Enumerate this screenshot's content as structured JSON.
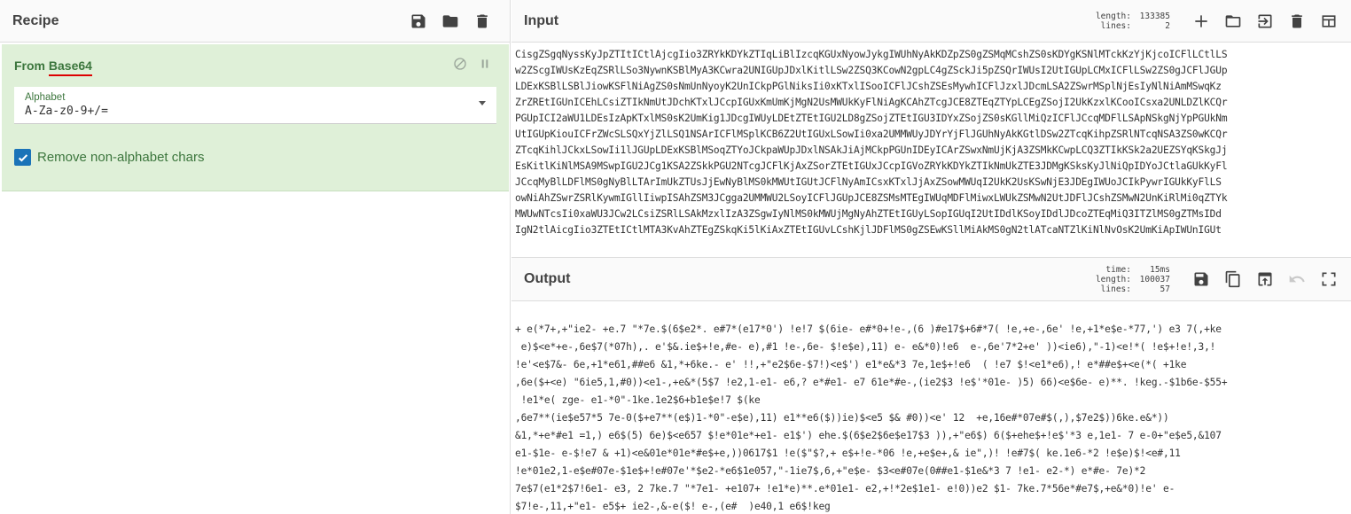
{
  "recipe": {
    "title": "Recipe",
    "operation": {
      "name_prefix": "From ",
      "name_highlight": "Base64",
      "arg_label": "Alphabet",
      "arg_value": "A-Za-z0-9+/=",
      "checkbox_label": "Remove non-alphabet chars",
      "checkbox_checked": true
    }
  },
  "input": {
    "title": "Input",
    "stats": {
      "length_label": "length:",
      "length_value": "133385",
      "lines_label": "lines:",
      "lines_value": "2"
    },
    "lines": [
      "CisgZSgqNyssKyJpZTItICtlAjcgIio3ZRYkKDYkZTIqLiBlIzcqKGUxNyowJykgIWUhNyAkKDZpZS0gZSMqMCshZS0sKDYgKSNlMTckKzYjKjcoICFlLCtlLS",
      "w2ZScgIWUsKzEqZSRlLSo3NywnKSBlMyA3KCwra2UNIGUpJDxlKitlLSw2ZSQ3KCowN2gpLC4gZSckJi5pZSQrIWUsI2UtIGUpLCMxICFlLSw2ZS0gJCFlJGUp",
      "LDExKSBlLSBlJiowKSFlNiAgZS0sNmUnNyoyK2UnICkpPGlNiksIi0xKTxlISooICFlJCshZSEsMywhICFlJzxlJDcmLSA2ZSwrMSplNjEsIyNlNiAmMSwqKz",
      "ZrZREtIGUnICEhLCsiZTIkNmUtJDchKTxlJCcpIGUxKmUmKjMgN2UsMWUkKyFlNiAgKCAhZTcgJCE8ZTEqZTYpLCEgZSojI2UkKzxlKCooICsxa2UNLDZlKCQr",
      "PGUpICI2aWU1LDEsIzApKTxlMS0sK2UmKig1JDcgIWUyLDEtZTEtIGU2LD8gZSojZTEtIGU3IDYxZSojZS0sKGllMiQzICFlJCcqMDFlLSApNSkgNjYpPGUkNm",
      "UtIGUpKiouICFrZWcSLSQxYjZlLSQ1NSArICFlMSplKCB6Z2UtIGUxLSowIi0xa2UMMWUyJDYrYjFlJGUhNyAkKGtlDSw2ZTcqKihpZSRlNTcqNSA3ZS0wKCQr",
      "ZTcqKihlJCkxLSowIi1lJGUpLDExKSBlMSoqZTYoJCkpaWUpJDxlNSAkJiAjMCkpPGUnIDEyICArZSwxNmUjKjA3ZSMkKCwpLCQ3ZTIkKSk2a2UEZSYqKSkgJj",
      "EsKitlKiNlMSA9MSwpIGU2JCg1KSA2ZSkkPGU2NTcgJCFlKjAxZSorZTEtIGUxJCcpIGVoZRYkKDYkZTIkNmUkZTE3JDMgKSksKyJlNiQpIDYoJCtlaGUkKyFl",
      "JCcqMyBlLDFlMS0gNyBlLTArImUkZTUsJjEwNyBlMS0kMWUtIGUtJCFlNyAmICsxKTxlJjAxZSowMWUqI2UkK2UsKSwNjE3JDEgIWUoJCIkPywrIGUkKyFlLS",
      "owNiAhZSwrZSRlKywmIGllIiwpISAhZSM3JCgga2UMMWU2LSoyICFlJGUpJCE8ZSMsMTEgIWUqMDFlMiwxLWUkZSMwN2UtJDFlJCshZSMwN2UnKiRlMi0qZTYk",
      "MWUwNTcsIi0xaWU3JCw2LCsiZSRlLSAkMzxlIzA3ZSgwIyNlMS0kMWUjMgNyAhZTEtIGUyLSopIGUqI2UtIDdlKSoyIDdlJDcoZTEqMiQ3ITZlMS0gZTMsIDd",
      "IgN2tlAicgIio3ZTEtICtlMTA3KvAhZTEgZSkqKi5lKiAxZTEtIGUvLCshKjlJDFlMS0gZSEwKSllMiAkMS0gN2tlATcaNTZlKiNlNvOsK2UmKiApIWUnIGUt"
    ]
  },
  "output": {
    "title": "Output",
    "stats": {
      "time_label": "time:",
      "time_value": "15ms",
      "length_label": "length:",
      "length_value": "100037",
      "lines_label": "lines:",
      "lines_value": "57"
    },
    "lines": [
      "+ e(*7+,+\"ie2- +e.7 \"*7e.$(6$e2*. e#7*(e17*0') !e!7 $(6ie- e#*0+!e-,(6 )#e17$+6#*7( !e,+e-,6e' !e,+1*e$e-*77,') e3 7(,+ke",
      " e)$<e*+e-,6e$7(*07h),. e'$&.ie$+!e,#e- e),#1 !e-,6e- $!e$e),11) e- e&*0)!e6  e-,6e'7*2+e' ))<ie6),\"-1)<e!*( !e$+!e!,3,!",
      "!e'<e$7&- 6e,+1*e61,##e6 &1,*+6ke.- e' !!,+\"e2$6e-$7!)<e$') e1*e&*3 7e,1e$+!e6  ( !e7 $!<e1*e6),! e*##e$+<e(*( +1ke",
      ",6e($+<e) \"6ie5,1,#0))<e1-,+e&*(5$7 !e2,1-e1- e6,? e*#e1- e7 61e*#e-,(ie2$3 !e$'*01e- )5) 66)<e$6e- e)**. !keg.-$1b6e-$55+",
      " !e1*e( zge- e1-*0\"-1ke.1e2$6+b1e$e!7 $(ke",
      ",6e7**(ie$e57*5 7e-0($+e7**(e$)1-*0\"-e$e),11) e1**e6($))ie)$<e5 $& #0))<e' 12  +e,16e#*07e#$(,),$7e2$))6ke.e&*))",
      "&1,*+e*#e1 =1,) e6$(5) 6e)$<e657 $!e*01e*+e1- e1$') ehe.$(6$e2$6e$e17$3 )),+\"e6$) 6($+ehe$+!e$'*3 e,1e1- 7 e-0+\"e$e5,&107",
      "e1-$1e- e-$!e7 & +1)<e&01e*01e*#e$+e,))0617$1 !e($\"$?,+ e$+!e-*06 !e,+e$e+,& ie\",)! !e#7$( ke.1e6-*2 !e$e)$!<e#,11",
      "!e*01e2,1-e$e#07e-$1e$+!e#07e'*$e2-*e6$1e057,\"-1ie7$,6,+\"e$e- $3<e#07e(0##e1-$1e&*3 7 !e1- e2-*) e*#e- 7e)*2",
      "7e$7(e1*2$7!6e1- e3, 2 7ke.7 \"*7e1- +e107+ !e1*e)**.e*01e1- e2,+!*2e$1e1- e!0))e2 $1- 7ke.7*56e*#e7$,+e&*0)!e' e-",
      "$7!e-,11,+\"e1- e5$+ ie2-,&-e($! e-,(e#  )e40,1 e6$!keg"
    ]
  },
  "colors": {
    "op_background": "#dff0d8",
    "op_text": "#3c763d",
    "checkbox": "#1a73b8",
    "highlight_underline": "#dd0000"
  },
  "icons": {
    "recipe": [
      "save-icon",
      "folder-icon",
      "trash-icon"
    ],
    "input": [
      "plus-icon",
      "folder-icon",
      "input-file-icon",
      "trash-icon",
      "layout-icon"
    ],
    "output": [
      "save-icon",
      "copy-icon",
      "replace-input-icon",
      "undo-icon",
      "maximize-icon"
    ],
    "op": [
      "disable-icon",
      "pause-icon"
    ]
  }
}
